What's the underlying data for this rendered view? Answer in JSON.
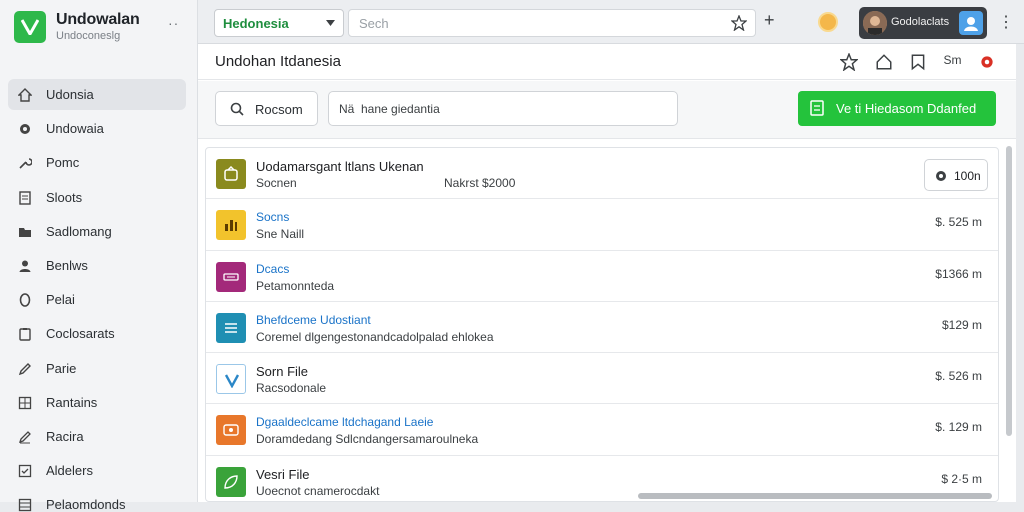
{
  "brand": {
    "name": "Undowalan",
    "subtitle": "Undoconeslg",
    "menu": "··"
  },
  "sidebar": {
    "items": [
      {
        "label": "Udonsia",
        "icon": "home-icon"
      },
      {
        "label": "Undowaia",
        "icon": "gear-icon"
      },
      {
        "label": "Pomc",
        "icon": "wrench-icon"
      },
      {
        "label": "Sloots",
        "icon": "document-icon"
      },
      {
        "label": "Sadlomang",
        "icon": "folder-icon"
      },
      {
        "label": "Benlws",
        "icon": "user-icon"
      },
      {
        "label": "Pelai",
        "icon": "shield-icon"
      },
      {
        "label": "Coclosarats",
        "icon": "clipboard-icon"
      },
      {
        "label": "Parie",
        "icon": "pencil-icon"
      },
      {
        "label": "Rantains",
        "icon": "grid-icon"
      },
      {
        "label": "Racira",
        "icon": "edit-icon"
      },
      {
        "label": "Aldelers",
        "icon": "checklist-icon"
      },
      {
        "label": "Pelaomdonds",
        "icon": "table-icon"
      }
    ]
  },
  "topbar": {
    "workspace": "Hedonesia",
    "address_placeholder": "Sech",
    "plus": "+",
    "profile_name": "Godolaclats",
    "kebab": "⋮"
  },
  "page": {
    "title": "Undohan Itdanesia",
    "head_text": "Sm"
  },
  "toolbar": {
    "search_label": "Rocsom",
    "filter_value": "Nä  hane giedantia",
    "primary_label": "Ve ti Hiedasom  Ddanfed"
  },
  "list": {
    "rows": [
      {
        "title": "Uodamarsgant ltlans Ukenan",
        "subtitle": "Socnen",
        "mid": "Nakrst $2000",
        "pill": "100n",
        "icon_color": "#8a8a1e"
      },
      {
        "title": "Socns",
        "subtitle": "Sne Naill",
        "value": "$. 525 m",
        "icon_color": "#f2c32c"
      },
      {
        "title": "Dcacs",
        "subtitle": "Petamonnteda",
        "value": "$1366 m",
        "icon_color": "#a3297a"
      },
      {
        "title": "Bhefdceme Udostiant",
        "subtitle": "Coremel dlgengestonandcadolpalad ehlokea",
        "value": "$129 m",
        "icon_color": "#1f8fb3"
      },
      {
        "title": "Sorn File",
        "subtitle": "Racsodonale",
        "value": "$. 526 m",
        "icon_color": "#2b87c7"
      },
      {
        "title": "Dgaaldeclcame ltdchagand Laeie",
        "subtitle": "Doramdedang Sdlcndangersamaroulneka",
        "value": "$. 129 m",
        "icon_color": "#e8772b"
      },
      {
        "title": "Vesri File",
        "subtitle": "Uoecnot cnamerocdakt",
        "value": "$ 2·5 m",
        "icon_color": "#3aa33a"
      }
    ]
  },
  "colors": {
    "accent_green": "#24c33c",
    "link_blue": "#1a73c8",
    "brand_green": "#2eb84a"
  }
}
